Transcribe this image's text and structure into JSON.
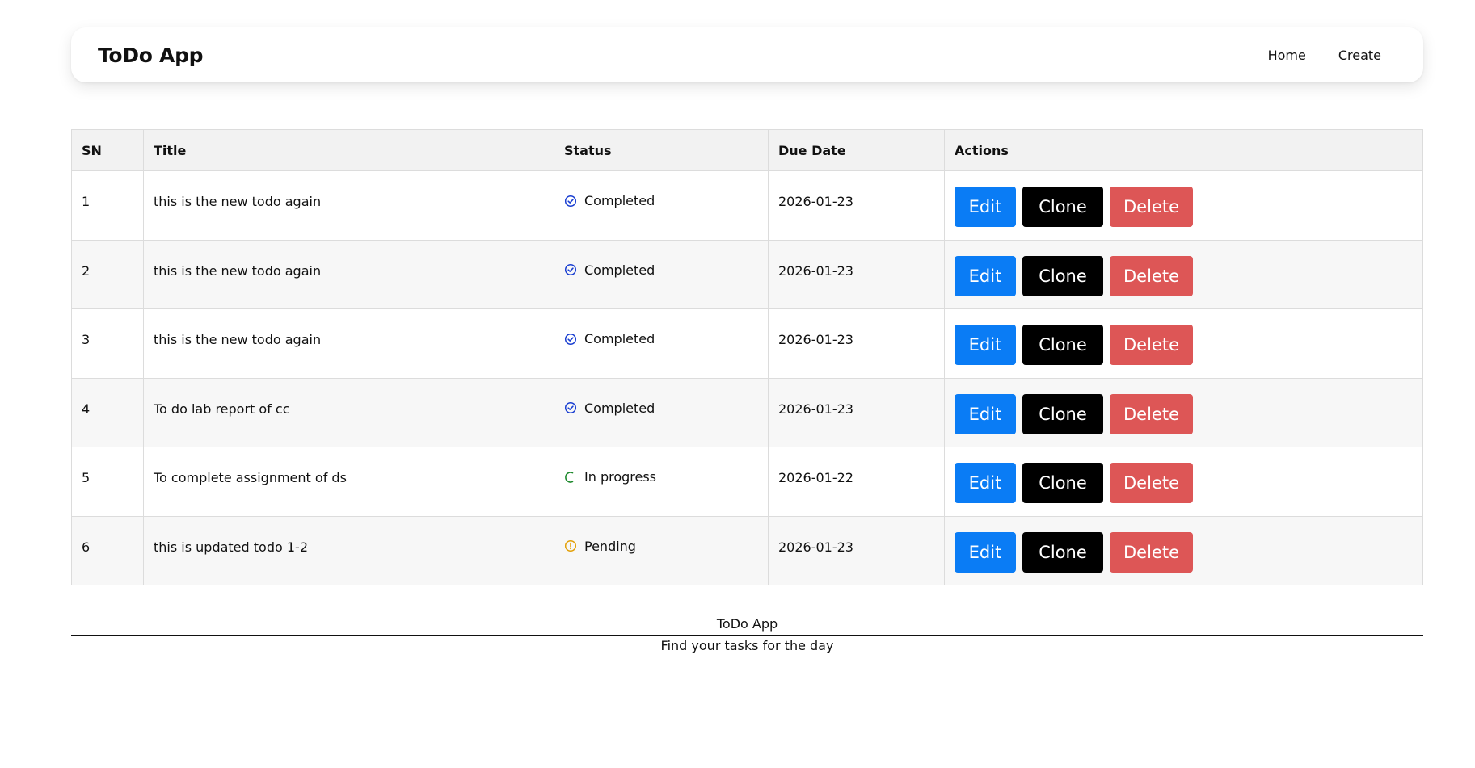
{
  "navbar": {
    "brand": "ToDo App",
    "links": [
      {
        "label": "Home"
      },
      {
        "label": "Create"
      }
    ]
  },
  "table": {
    "headers": [
      "SN",
      "Title",
      "Status",
      "Due Date",
      "Actions"
    ],
    "rows": [
      {
        "sn": "1",
        "title": "this is the new todo again",
        "status": "Completed",
        "status_icon": "check-circle-icon",
        "due": "2026-01-23"
      },
      {
        "sn": "2",
        "title": "this is the new todo again",
        "status": "Completed",
        "status_icon": "check-circle-icon",
        "due": "2026-01-23"
      },
      {
        "sn": "3",
        "title": "this is the new todo again",
        "status": "Completed",
        "status_icon": "check-circle-icon",
        "due": "2026-01-23"
      },
      {
        "sn": "4",
        "title": "To do lab report of cc",
        "status": "Completed",
        "status_icon": "check-circle-icon",
        "due": "2026-01-23"
      },
      {
        "sn": "5",
        "title": "To complete assignment of ds",
        "status": "In progress",
        "status_icon": "progress-arc-icon",
        "due": "2026-01-22"
      },
      {
        "sn": "6",
        "title": "this is updated todo 1-2",
        "status": "Pending",
        "status_icon": "warning-circle-icon",
        "due": "2026-01-23"
      }
    ],
    "actions": {
      "edit_label": "Edit",
      "clone_label": "Clone",
      "delete_label": "Delete"
    }
  },
  "footer": {
    "title": "ToDo App",
    "subtitle": "Find your tasks for the day"
  },
  "colors": {
    "edit": "#0a7cf5",
    "clone": "#000000",
    "delete": "#dd5656",
    "completed": "#1a3fd1",
    "in_progress": "#1f8a2e",
    "pending": "#e3a008"
  }
}
